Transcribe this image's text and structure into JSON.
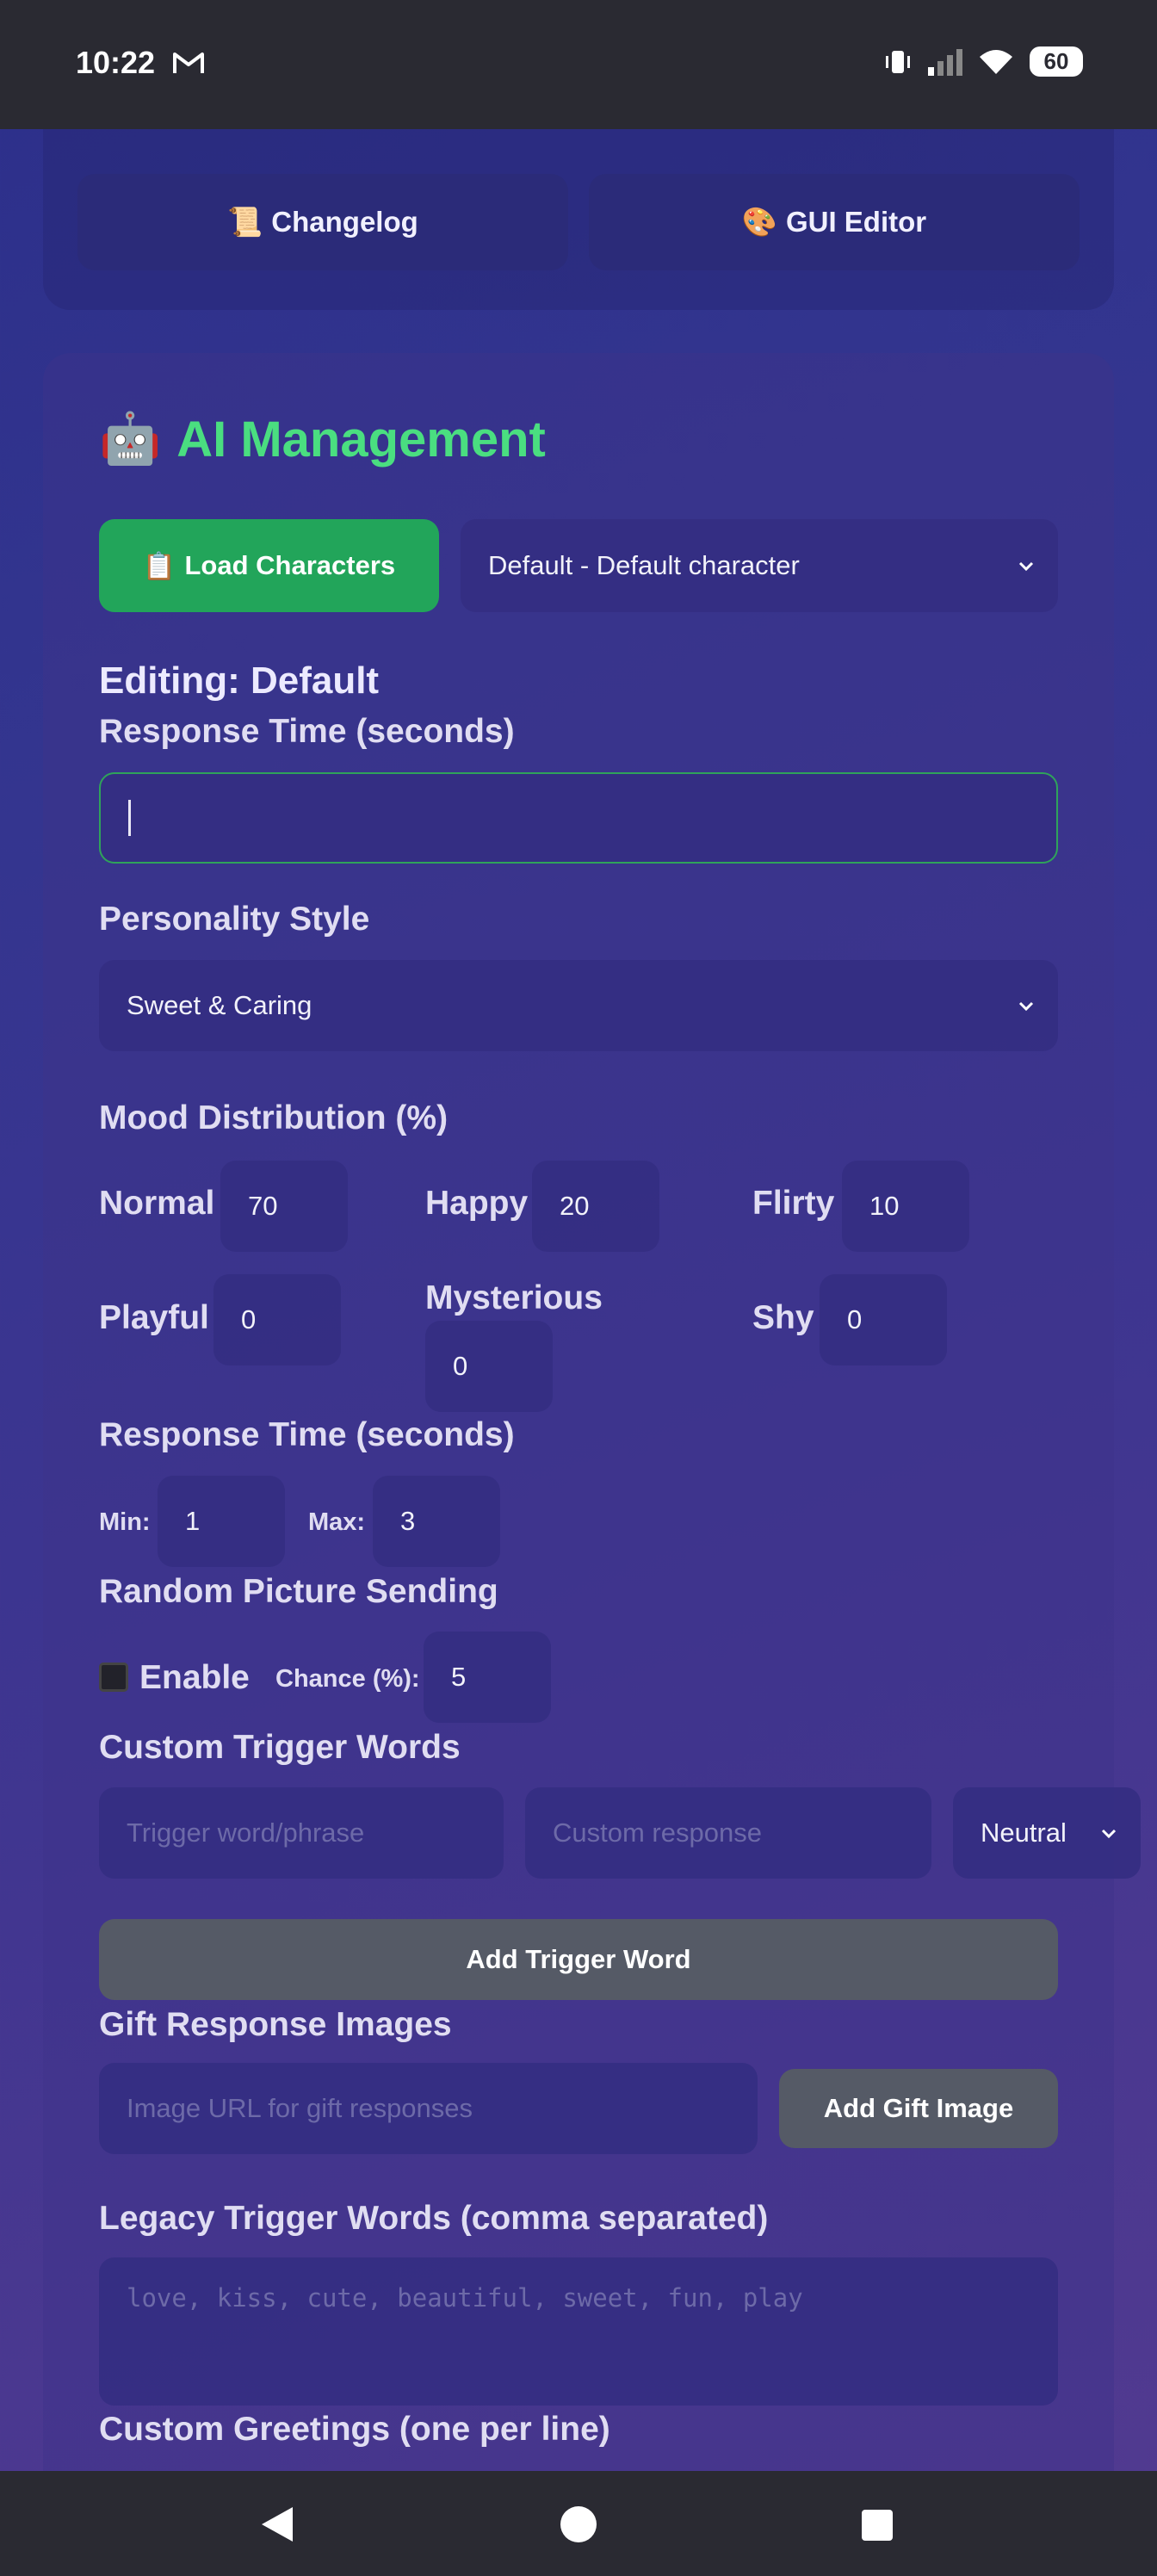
{
  "status_bar": {
    "time": "10:22",
    "battery": "60"
  },
  "top_buttons": {
    "changelog": {
      "icon": "scroll-icon",
      "label": "Changelog"
    },
    "gui_editor": {
      "icon": "palette-icon",
      "label": "GUI Editor"
    }
  },
  "ai_management": {
    "title": "AI Management",
    "title_icon": "robot-icon",
    "load_button": "Load Characters",
    "character_select": "Default - Default character",
    "editing_label": "Editing: Default",
    "response_time_label": "Response Time (seconds)",
    "response_time_value": "",
    "personality_label": "Personality Style",
    "personality_value": "Sweet & Caring",
    "mood_label": "Mood Distribution (%)",
    "moods": [
      {
        "name": "Normal",
        "value": "70"
      },
      {
        "name": "Happy",
        "value": "20"
      },
      {
        "name": "Flirty",
        "value": "10"
      },
      {
        "name": "Playful",
        "value": "0"
      },
      {
        "name": "Mysterious",
        "value": "0"
      },
      {
        "name": "Shy",
        "value": "0"
      }
    ],
    "response_time_label2": "Response Time (seconds)",
    "min_label": "Min:",
    "min_value": "1",
    "max_label": "Max:",
    "max_value": "3",
    "random_pic_label": "Random Picture Sending",
    "enable_label": "Enable",
    "enable_checked": false,
    "chance_label": "Chance (%):",
    "chance_value": "5",
    "custom_trigger_label": "Custom Trigger Words",
    "trigger_placeholder": "Trigger word/phrase",
    "response_placeholder": "Custom response",
    "trigger_mood": "Neutral",
    "add_trigger_button": "Add Trigger Word",
    "gift_label": "Gift Response Images",
    "gift_placeholder": "Image URL for gift responses",
    "add_gift_button": "Add Gift Image",
    "legacy_label": "Legacy Trigger Words (comma separated)",
    "legacy_placeholder": "love, kiss, cute, beautiful, sweet, fun, play",
    "greetings_label": "Custom Greetings (one per line)"
  },
  "colors": {
    "accent_green": "#22a55a",
    "title_green": "#4ade80",
    "button_gray": "#555a66"
  }
}
